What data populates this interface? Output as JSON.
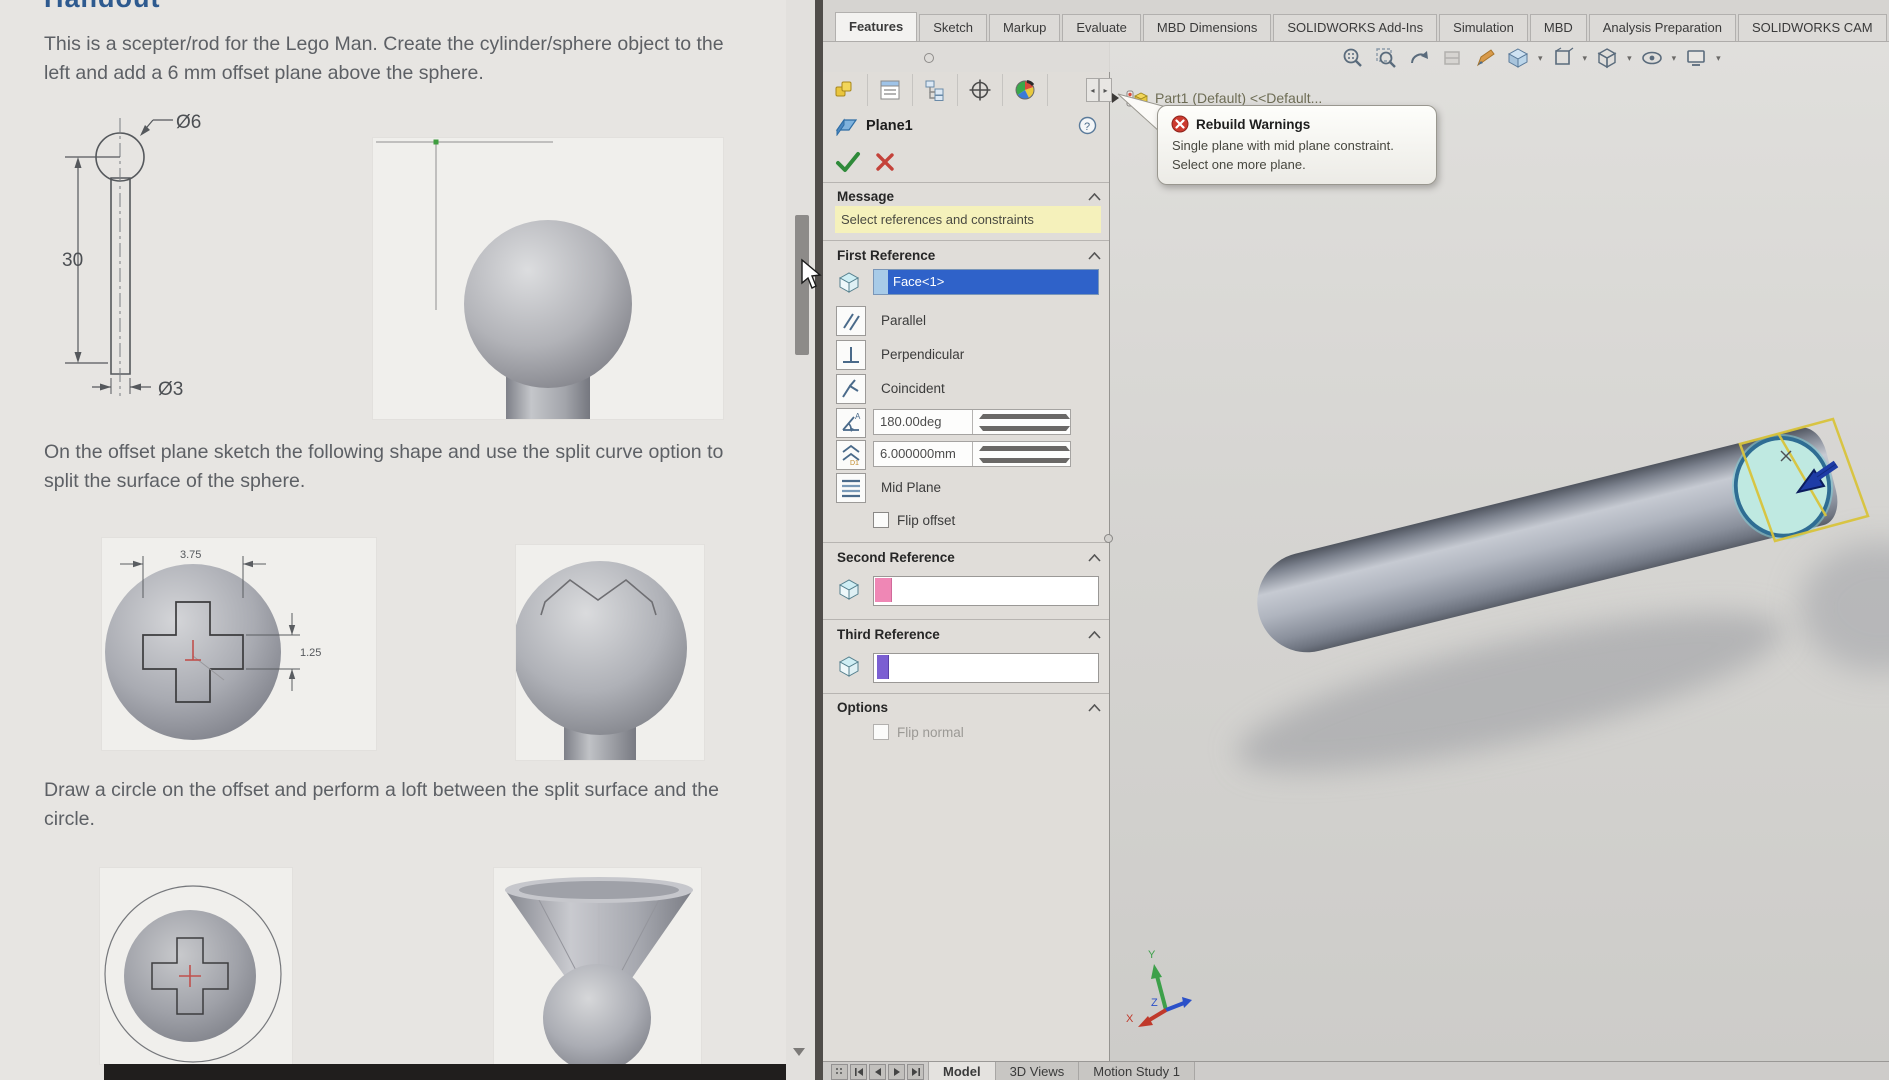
{
  "colors": {
    "selection_blue": "#2f62c9",
    "message_yellow": "#f5f1bb",
    "face_highlight_teal": "#bfe9e1",
    "plane_preview_yellow": "#d9c43c",
    "second_ref_pink": "#ef87b5",
    "third_ref_purple": "#7b5fd2",
    "error_red": "#c4423a",
    "ok_green": "#2f8a3a"
  },
  "document": {
    "heading_clipped": "Handout",
    "para1": "This is a scepter/rod for the Lego Man. Create the cylinder/sphere object to the left and add a 6 mm offset plane above the sphere.",
    "para2": "On the offset plane sketch the following shape and use the split curve option to split the surface of the sphere.",
    "para3": "Draw a circle on the offset and perform a loft between the split surface and the circle.",
    "drawing_dims": {
      "sphere_diameter": "Ø6",
      "rod_length": "30",
      "rod_diameter": "Ø3"
    },
    "sketch_dims": {
      "cross_width": "3.75",
      "cross_bar": "1.25"
    }
  },
  "ribbon": {
    "tabs": [
      {
        "label": "Features",
        "active": true
      },
      {
        "label": "Sketch"
      },
      {
        "label": "Markup"
      },
      {
        "label": "Evaluate"
      },
      {
        "label": "MBD Dimensions"
      },
      {
        "label": "SOLIDWORKS Add-Ins"
      },
      {
        "label": "Simulation"
      },
      {
        "label": "MBD"
      },
      {
        "label": "Analysis Preparation"
      },
      {
        "label": "SOLIDWORKS CAM"
      }
    ]
  },
  "property_manager": {
    "title": "Plane1",
    "message_header": "Message",
    "message": "Select references and constraints",
    "first_reference": {
      "header": "First Reference",
      "selection": "Face<1>",
      "parallel": "Parallel",
      "perpendicular": "Perpendicular",
      "coincident": "Coincident",
      "angle_value": "180.00deg",
      "offset_value": "6.000000mm",
      "mid_plane": "Mid Plane",
      "flip_offset": "Flip offset"
    },
    "second_reference": {
      "header": "Second Reference"
    },
    "third_reference": {
      "header": "Third Reference"
    },
    "options": {
      "header": "Options",
      "flip_normal": "Flip normal"
    }
  },
  "feature_tree": {
    "root_item": "Part1 (Default) <<Default..."
  },
  "rebuild_tooltip": {
    "title": "Rebuild Warnings",
    "line1": "Single plane with mid plane constraint.",
    "line2": "Select one more plane."
  },
  "viewport": {
    "triad_x": "X",
    "triad_y": "Y",
    "triad_z": "Z"
  },
  "bottom_bar": {
    "tabs": [
      {
        "label": "Model",
        "active": true
      },
      {
        "label": "3D Views"
      },
      {
        "label": "Motion Study 1"
      }
    ]
  }
}
